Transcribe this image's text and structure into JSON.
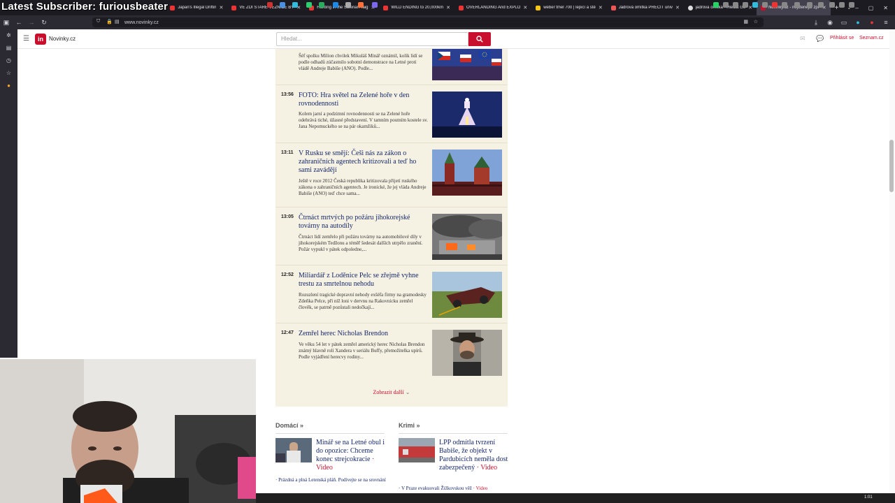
{
  "overlay": {
    "text": "Latest Subscriber: furiousbeater"
  },
  "browser": {
    "tabs": [
      {
        "label": "Japan's Illegal Driftin",
        "color": "#e33"
      },
      {
        "label": "VE ZDI STARÉ VĚZNICE BYL",
        "color": "#e33"
      },
      {
        "label": "Hunting in the Siberian Taig",
        "color": "#e33"
      },
      {
        "label": "WILD ENDING to 20,000km",
        "color": "#e33"
      },
      {
        "label": "OVERLANDING And EXPLO",
        "color": "#e33"
      },
      {
        "label": "weber tmel 700 | lepicí a stě",
        "color": "#f5c518"
      },
      {
        "label": "Jádrová omítka PRECIT univ",
        "color": "#e55"
      },
      {
        "label": "jadrova omitka - Hledat Go",
        "color": "#ddd"
      },
      {
        "label": "Novinky.cz - nejčtenější zpr",
        "color": "#c8102e",
        "active": true
      }
    ],
    "url": "www.novinky.cz"
  },
  "site": {
    "name": "Novinky.cz",
    "logo_letter": "in",
    "search_placeholder": "Hledat...",
    "login": "Přihlásit se",
    "seznam": "Seznam.cz"
  },
  "feed": {
    "items": [
      {
        "time": "",
        "title": "",
        "perex": "Šéf spolku Milion chvilek Mikuláš Minář oznámil, kolik lidí se podle odhadů zúčastnilo sobotní demonstrace na Letné proti vládě Andreje Babiše (ANO). Podle..."
      },
      {
        "time": "13:56",
        "title": "FOTO: Hra světel na Zelené hoře v den rovnodennosti",
        "perex": "Kolem jarní a podzimní rovnodennosti se na Zelené hoře odehrává tiché, úžasné představení. V tamním poutním kostele sv. Jana Nepomuckého se na pár okamžiků..."
      },
      {
        "time": "13:11",
        "title": "V Rusku se smějí: Češi nás za zákon o zahraničních agentech kritizovali a teď ho sami zavádějí",
        "perex": "Ještě v roce 2012 Česká republika kritizovala přijetí ruského zákona o zahraničních agentech. Je ironické, že jej vláda Andreje Babiše (ANO) teď chce sama..."
      },
      {
        "time": "13:05",
        "title": "Čtrnáct mrtvých po požáru jihokorejské továrny na autodíly",
        "perex": "Čtrnáct lidí zemřelo při požáru továrny na automobilové díly v jihokorejském Tedžonu a téměř šedesát dalších utrpělo zranění. Požár vypukl v pátek odpoledne,..."
      },
      {
        "time": "12:52",
        "title": "Miliardář z Loděnice Pelc se zřejmě vyhne trestu za smrtelnou nehodu",
        "perex": "Rozuzlení tragické dopravní nehody exšéfa firmy na gramodesky Zdeňka Pelce, při níž loni v dervnu na Rakovnicku zemřel člověk, se patrně pozůstali nedočkají..."
      },
      {
        "time": "12:47",
        "title": "Zemřel herec Nicholas Brendon",
        "perex": "Ve věku 54 let v pátek zemřel americký herec Nicholas Brendon známý hlavně rolí Xandera v seriálu Buffy, přemožitelka upírů. Podle vyjádření herecvy rodiny..."
      }
    ],
    "more": "Zobrazit další"
  },
  "sections": {
    "domaci": {
      "title": "Domácí »",
      "headline": "Minář se na Letné obul i do opozice: Chceme konec strejcokracie",
      "video": " · Video",
      "sub": "· Prázdná a plná Letenská pláň. Podívejte se na srovnání"
    },
    "krimi": {
      "title": "Krimi »",
      "headline": "LPP odmítla tvrzení Babiše, že objekt v Pardubicích neměla dost zabezpečený",
      "video": " · Video",
      "sub": "· V Praze evakuovali Žižkovskou věž",
      "sub_video": " · Video"
    }
  },
  "taskbar": {
    "time": "1:01"
  },
  "colors": {
    "accent": "#c8102e",
    "feed_bg": "#f5f1e3",
    "headline": "#15286b"
  }
}
